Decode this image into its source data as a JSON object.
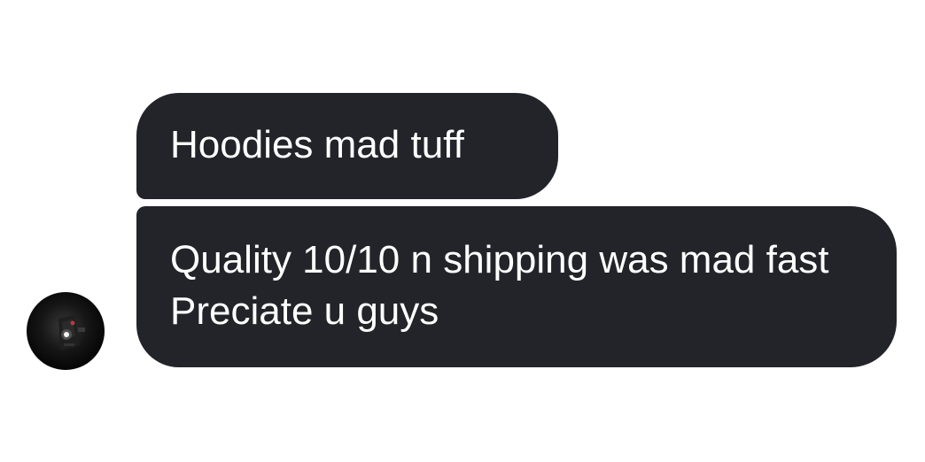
{
  "messages": [
    {
      "text": "Hoodies mad tuff"
    },
    {
      "text": "Quality 10/10 n shipping was mad fast Preciate u guys"
    }
  ],
  "avatar": {
    "icon": "profile-photo"
  },
  "colors": {
    "bubble_background": "#222429",
    "bubble_text": "#ffffff",
    "page_background": "#ffffff"
  }
}
